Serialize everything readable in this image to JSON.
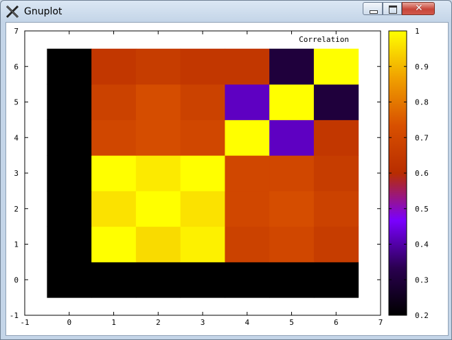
{
  "window": {
    "title": "Gnuplot",
    "close_glyph": "✕"
  },
  "icons": {
    "app": "gnuplot-x-icon",
    "minimize": "minimize-icon",
    "maximize": "maximize-icon",
    "close": "close-icon"
  },
  "chart_data": {
    "type": "heatmap",
    "title": "",
    "legend_entry": "Correlation",
    "xlim": [
      -1,
      7
    ],
    "ylim": [
      -1,
      7
    ],
    "x_ticks": [
      "-1",
      "0",
      "1",
      "2",
      "3",
      "4",
      "5",
      "6",
      "7"
    ],
    "y_ticks": [
      "-1",
      "0",
      "1",
      "2",
      "3",
      "4",
      "5",
      "6",
      "7"
    ],
    "colorbar": {
      "range": [
        0.2,
        1
      ],
      "ticks": [
        "0.2",
        "0.3",
        "0.4",
        "0.5",
        "0.6",
        "0.7",
        "0.8",
        "0.9",
        "1"
      ],
      "palette": [
        "#000000",
        "#2a0050",
        "#7a00ff",
        "#b82d00",
        "#d85000",
        "#f0a000",
        "#ffff00"
      ]
    },
    "x_categories": [
      0,
      1,
      2,
      3,
      4,
      5,
      6
    ],
    "y_categories": [
      0,
      1,
      2,
      3,
      4,
      5,
      6
    ],
    "rows": [
      [
        0.2,
        0.2,
        0.2,
        0.2,
        0.2,
        0.2,
        0.2
      ],
      [
        0.2,
        1.0,
        0.95,
        0.98,
        0.68,
        0.7,
        0.66
      ],
      [
        0.2,
        0.96,
        1.0,
        0.96,
        0.7,
        0.72,
        0.68
      ],
      [
        0.2,
        1.0,
        0.97,
        1.0,
        0.7,
        0.7,
        0.66
      ],
      [
        0.2,
        0.7,
        0.72,
        0.7,
        1.0,
        0.42,
        0.64
      ],
      [
        0.2,
        0.68,
        0.72,
        0.68,
        0.42,
        1.0,
        0.3
      ],
      [
        0.2,
        0.64,
        0.66,
        0.64,
        0.64,
        0.3,
        1.0
      ]
    ]
  }
}
